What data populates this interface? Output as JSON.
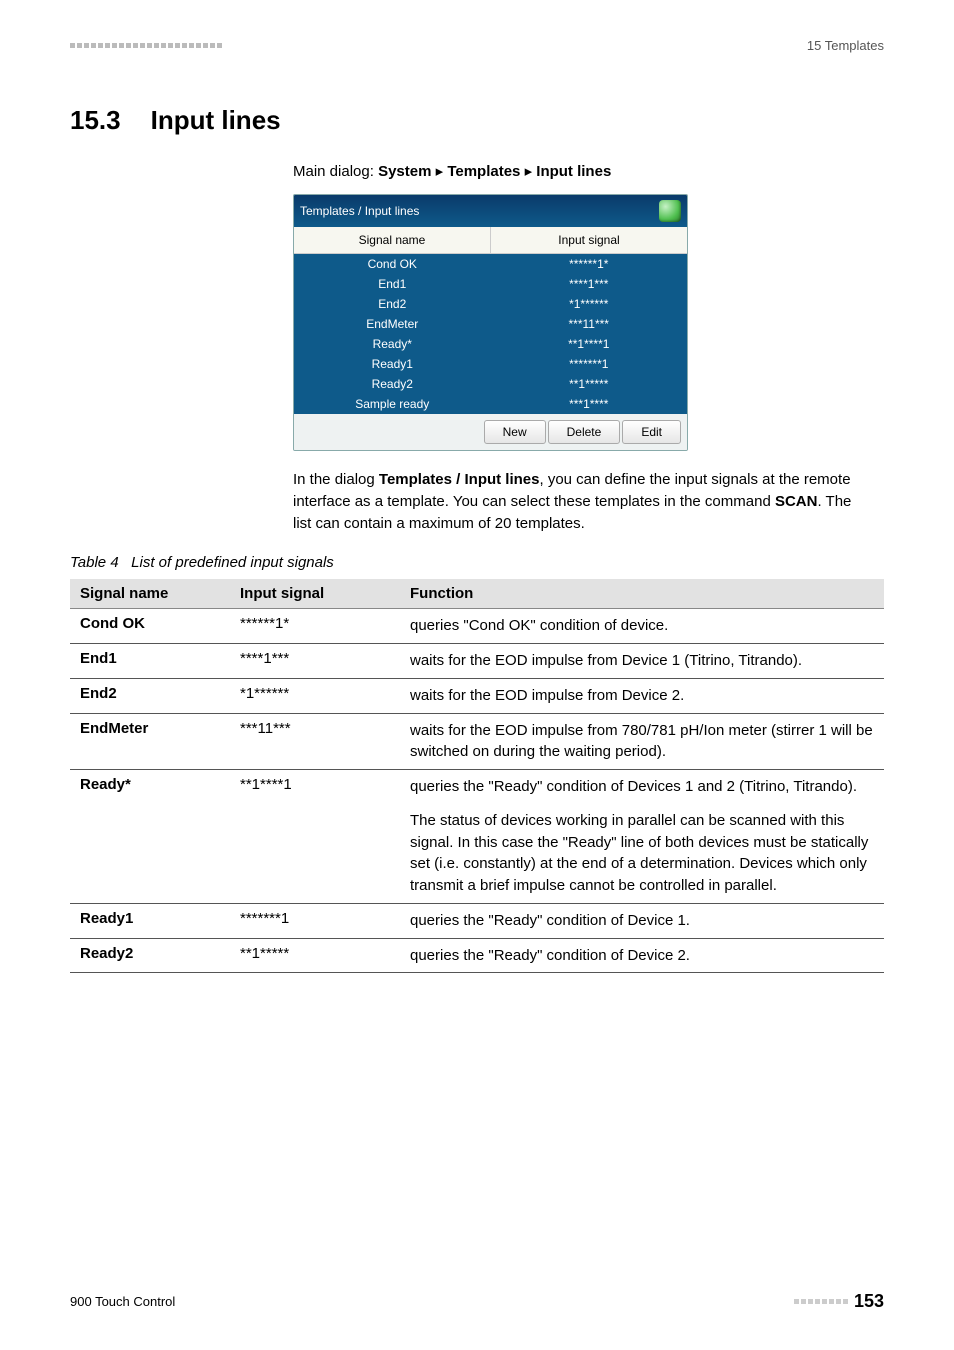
{
  "header": {
    "right_label": "15 Templates"
  },
  "section": {
    "number": "15.3",
    "title": "Input lines"
  },
  "breadcrumb": {
    "prefix": "Main dialog: ",
    "b1": "System",
    "sep": " ▸ ",
    "b2": "Templates",
    "b3": "Input lines"
  },
  "dialog": {
    "title": "Templates / Input lines",
    "col1": "Signal name",
    "col2": "Input signal",
    "rows": [
      {
        "name": "Cond OK",
        "sig": "******1*"
      },
      {
        "name": "End1",
        "sig": "****1***"
      },
      {
        "name": "End2",
        "sig": "*1******"
      },
      {
        "name": "EndMeter",
        "sig": "***11***"
      },
      {
        "name": "Ready*",
        "sig": "**1****1"
      },
      {
        "name": "Ready1",
        "sig": "*******1"
      },
      {
        "name": "Ready2",
        "sig": "**1*****"
      },
      {
        "name": "Sample ready",
        "sig": "***1****"
      }
    ],
    "buttons": {
      "new": "New",
      "delete": "Delete",
      "edit": "Edit"
    }
  },
  "paragraph": {
    "p1a": "In the dialog ",
    "p1b": "Templates / Input lines",
    "p1c": ", you can define the input signals at the remote interface as a template. You can select these templates in the command ",
    "p1d": "SCAN",
    "p1e": ". The list can contain a maximum of 20 templates."
  },
  "table_caption": {
    "label": "Table 4",
    "text": "List of predefined input signals"
  },
  "table": {
    "h1": "Signal name",
    "h2": "Input signal",
    "h3": "Function",
    "rows": [
      {
        "name": "Cond OK",
        "sig": "******1*",
        "func": "queries \"Cond OK\" condition of device."
      },
      {
        "name": "End1",
        "sig": "****1***",
        "func": "waits for the EOD impulse from Device 1 (Titrino, Titrando)."
      },
      {
        "name": "End2",
        "sig": "*1******",
        "func": "waits for the EOD impulse from Device 2."
      },
      {
        "name": "EndMeter",
        "sig": "***11***",
        "func": "waits for the EOD impulse from 780/781 pH/Ion meter (stirrer 1 will be switched on during the waiting period)."
      },
      {
        "name": "Ready*",
        "sig": "**1****1",
        "func": "queries the \"Ready\" condition of Devices 1 and 2 (Titrino, Titrando).",
        "extra": "The status of devices working in parallel can be scanned with this signal. In this case the \"Ready\" line of both devices must be statically set (i.e. constantly) at the end of a determination. Devices which only transmit a brief impulse cannot be controlled in parallel."
      },
      {
        "name": "Ready1",
        "sig": "*******1",
        "func": "queries the \"Ready\" condition of Device 1."
      },
      {
        "name": "Ready2",
        "sig": "**1*****",
        "func": "queries the \"Ready\" condition of Device 2."
      }
    ]
  },
  "footer": {
    "left": "900 Touch Control",
    "page": "153"
  }
}
